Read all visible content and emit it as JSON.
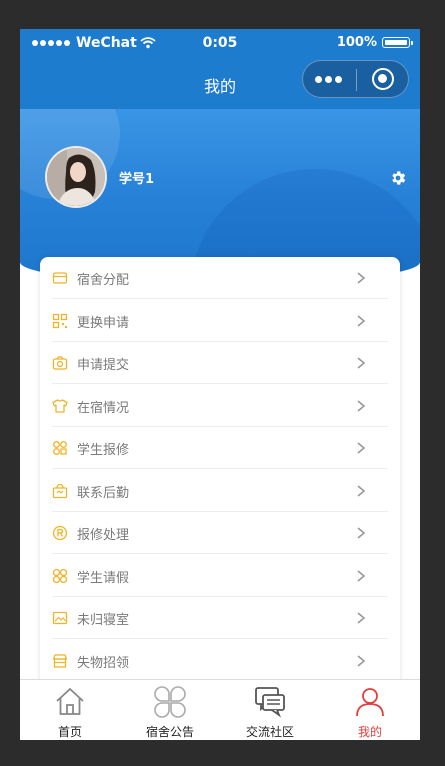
{
  "status_bar": {
    "carrier": "WeChat",
    "time": "0:05",
    "battery": "100%"
  },
  "navbar": {
    "title": "我的",
    "capsule_icons": [
      "more-dots-icon",
      "target-close-icon"
    ]
  },
  "profile": {
    "username": "学号1",
    "settings_icon": "gear-icon"
  },
  "menu": {
    "items": [
      {
        "label": "宿舍分配",
        "icon": "card-icon"
      },
      {
        "label": "更换申请",
        "icon": "grid-qr-icon"
      },
      {
        "label": "申请提交",
        "icon": "camera-icon"
      },
      {
        "label": "在宿情况",
        "icon": "shirt-icon"
      },
      {
        "label": "学生报修",
        "icon": "users-icon"
      },
      {
        "label": "联系后勤",
        "icon": "bag-icon"
      },
      {
        "label": "报修处理",
        "icon": "registered-icon"
      },
      {
        "label": "学生请假",
        "icon": "apps-icon"
      },
      {
        "label": "未归寝室",
        "icon": "image-icon"
      },
      {
        "label": "失物招领",
        "icon": "shop-icon"
      }
    ]
  },
  "tabbar": {
    "tabs": [
      {
        "label": "首页",
        "icon": "home-icon",
        "active": false
      },
      {
        "label": "宿舍公告",
        "icon": "clover-icon",
        "active": false
      },
      {
        "label": "交流社区",
        "icon": "chat-bubbles-icon",
        "active": false
      },
      {
        "label": "我的",
        "icon": "user-icon",
        "active": true
      }
    ]
  },
  "colors": {
    "primary_blue": "#1e7ccf",
    "icon_gold": "#f0b429",
    "active_red": "#e33d3d"
  }
}
